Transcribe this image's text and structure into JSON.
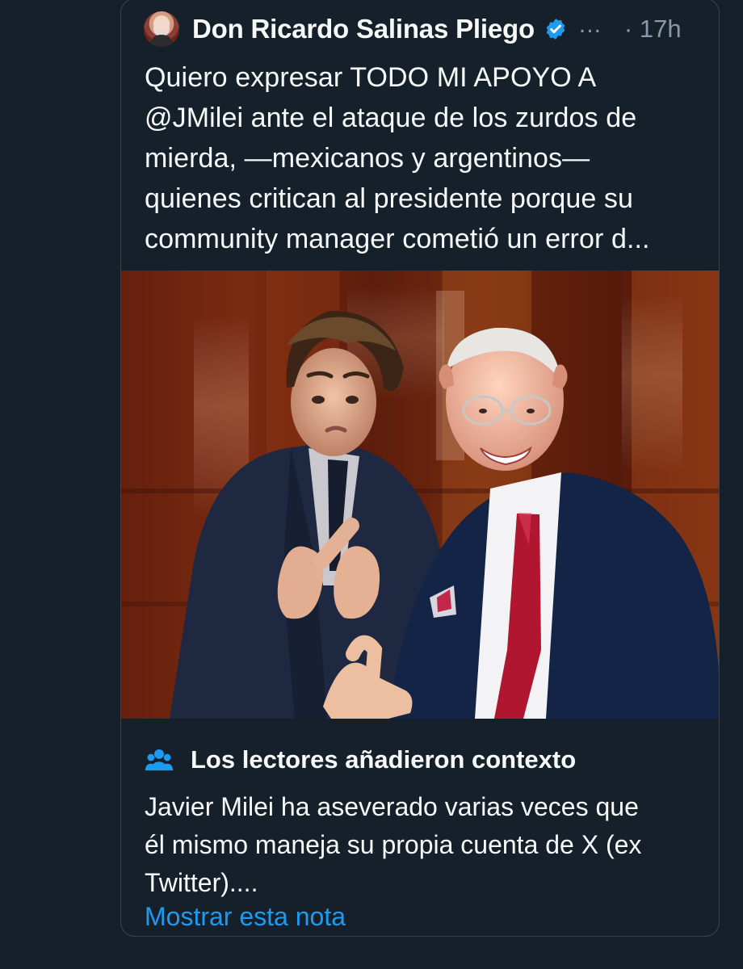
{
  "post": {
    "author_name": "Don Ricardo Salinas Pliego",
    "more_label": "...",
    "timestamp": "· 17h",
    "text_lines": [
      "Quiero expresar TODO MI APOYO A",
      "@JMilei ante el ataque de los zurdos de",
      "mierda, —mexicanos y argentinos—",
      "quienes critican al presidente porque su",
      "community manager cometió un error d..."
    ]
  },
  "community_note": {
    "title": "Los lectores añadieron contexto",
    "text_lines": [
      "Javier Milei ha aseverado varias veces que",
      "él mismo maneja su propia cuenta de X (ex",
      "Twitter)...."
    ],
    "link_label": "Mostrar esta nota"
  },
  "icons": {
    "verified": "verified-badge-icon",
    "people": "people-icon",
    "avatar": "avatar"
  },
  "colors": {
    "background": "#15202b",
    "card_border": "#38444d",
    "text": "#f7f9f9",
    "muted": "#8b98a5",
    "accent": "#1d9bf0"
  }
}
